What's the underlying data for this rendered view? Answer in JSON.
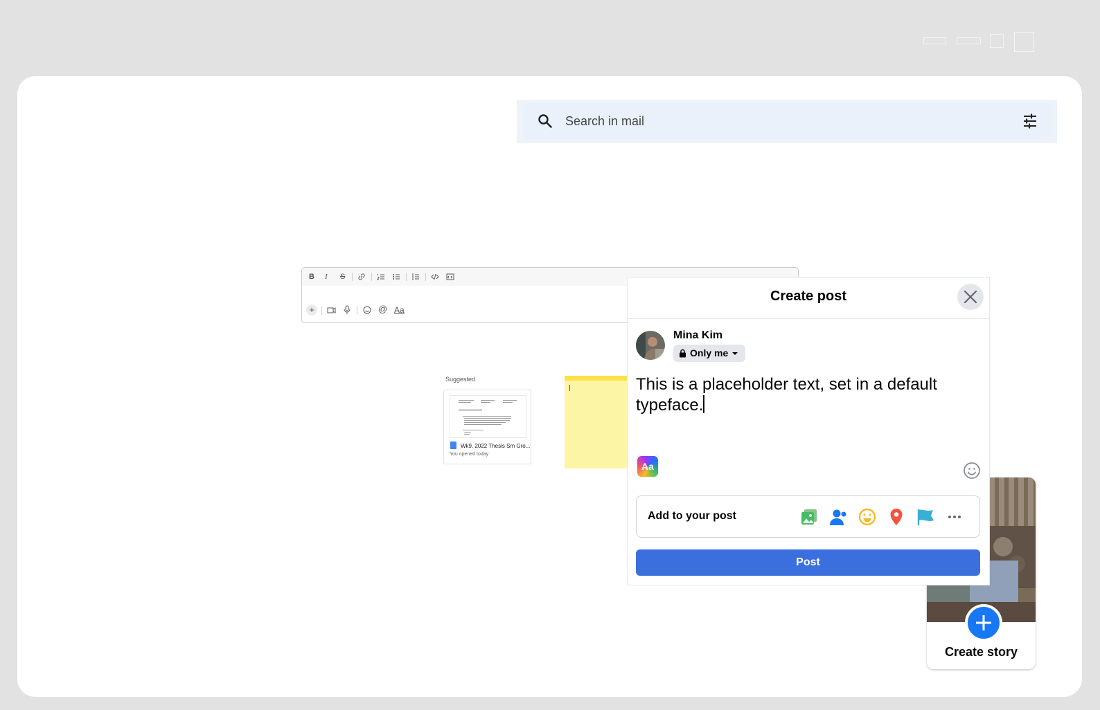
{
  "search": {
    "placeholder": "Search in mail"
  },
  "editor": {
    "toolbar": [
      "B",
      "I",
      "S"
    ],
    "bottom": [
      "+",
      "@",
      "Aa"
    ]
  },
  "suggested": {
    "label": "Suggested",
    "doc_title": "Wk9. 2022 Thesis Sm Gro...",
    "doc_subtitle": "You opened today"
  },
  "story": {
    "label": "Create story"
  },
  "modal": {
    "title": "Create post",
    "user_name": "Mina Kim",
    "privacy": "Only me",
    "post_text": "This is a placeholder text, set in a default typeface.",
    "aa_label": "Aa",
    "add_to_post": "Add to your post",
    "post_button": "Post"
  },
  "colors": {
    "primary": "#3b6fdd",
    "story_blue": "#1877f2",
    "search_bg": "#eaf1fb"
  },
  "icons": [
    "search-icon",
    "tune-icon",
    "close-icon",
    "lock-icon",
    "caret-down-icon",
    "emoji-icon",
    "photo-icon",
    "tag-people-icon",
    "feeling-icon",
    "location-icon",
    "flag-icon",
    "more-icon",
    "plus-icon"
  ]
}
